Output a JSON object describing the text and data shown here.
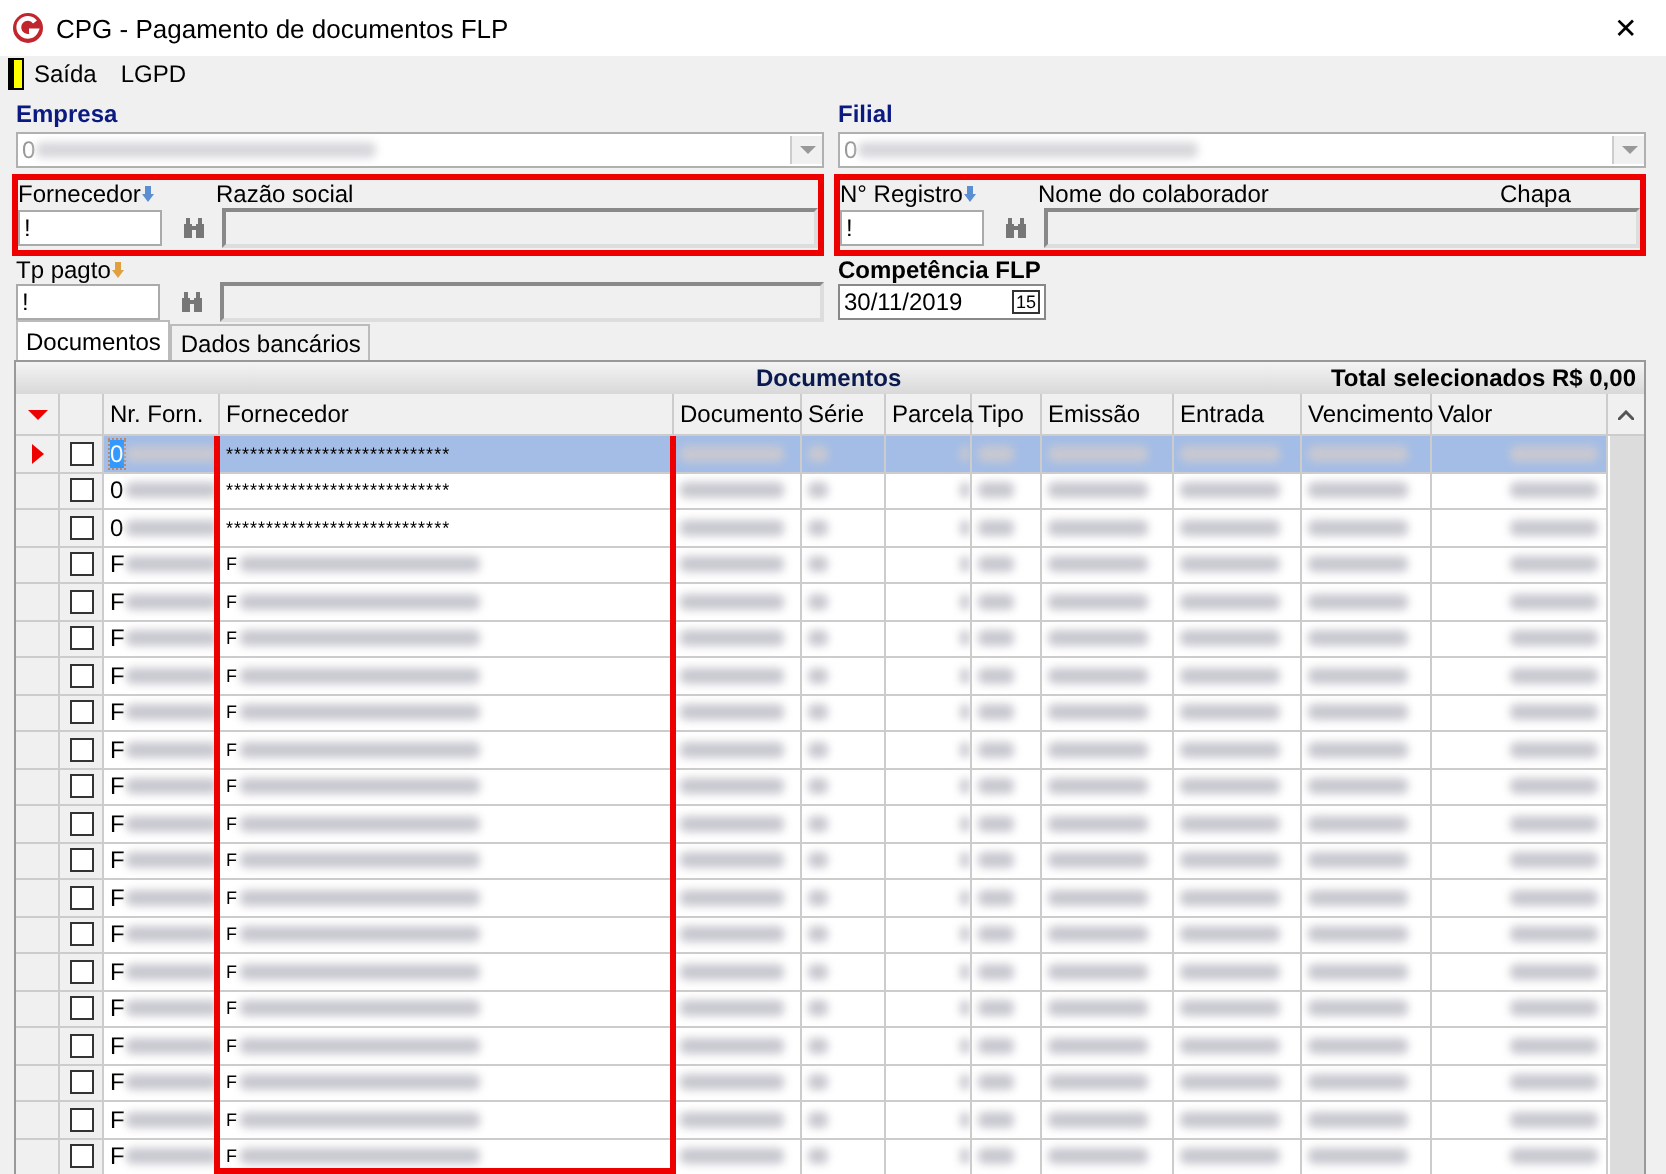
{
  "window": {
    "title": "CPG - Pagamento de documentos FLP",
    "close": "✕"
  },
  "menu": [
    {
      "label": "Saída",
      "kind": "exit"
    },
    {
      "label": "LGPD",
      "kind": "plain"
    }
  ],
  "empresa": {
    "label": "Empresa",
    "value": "0",
    "disabled": true
  },
  "filial": {
    "label": "Filial",
    "value": "0",
    "disabled": true
  },
  "fornecedor": {
    "label": "Fornecedor",
    "value": "!",
    "name_label": "Razão social",
    "highlighted": true
  },
  "registro": {
    "label": "N° Registro",
    "value": "!",
    "name_label": "Nome do colaborador",
    "chapa_label": "Chapa",
    "highlighted": true
  },
  "tp_pagto": {
    "label": "Tp pagto",
    "value": "!"
  },
  "competencia": {
    "label": "Competência FLP",
    "value": "30/11/2019",
    "calendar": "15"
  },
  "tabs": [
    {
      "label": "Documentos",
      "selected": true
    },
    {
      "label": "Dados bancários",
      "selected": false
    }
  ],
  "grid": {
    "title": "Documentos",
    "total": "Total selecionados R$ 0,00",
    "columns": [
      {
        "label": "Nr. Forn.",
        "highlighted": false
      },
      {
        "label": "Fornecedor",
        "highlighted": true
      },
      {
        "label": "Documento",
        "highlighted": false
      },
      {
        "label": "Série",
        "highlighted": false
      },
      {
        "label": "Parcela",
        "highlighted": false
      },
      {
        "label": "Tipo",
        "highlighted": false
      },
      {
        "label": "Emissão",
        "highlighted": false
      },
      {
        "label": "Entrada",
        "highlighted": false
      },
      {
        "label": "Vencimento",
        "highlighted": false
      },
      {
        "label": "Valor",
        "highlighted": false
      }
    ],
    "rows": [
      {
        "nr": "0",
        "fornecedor": "****************************",
        "selected": true,
        "checked": false
      },
      {
        "nr": "0",
        "fornecedor": "****************************",
        "selected": false,
        "checked": false
      },
      {
        "nr": "0",
        "fornecedor": "****************************",
        "selected": false,
        "checked": false
      },
      {
        "nr": "F",
        "fornecedor": "F",
        "selected": false,
        "checked": false
      },
      {
        "nr": "F",
        "fornecedor": "F",
        "selected": false,
        "checked": false
      },
      {
        "nr": "F",
        "fornecedor": "F",
        "selected": false,
        "checked": false
      },
      {
        "nr": "F",
        "fornecedor": "F",
        "selected": false,
        "checked": false
      },
      {
        "nr": "F",
        "fornecedor": "F",
        "selected": false,
        "checked": false
      },
      {
        "nr": "F",
        "fornecedor": "F",
        "selected": false,
        "checked": false
      },
      {
        "nr": "F",
        "fornecedor": "F",
        "selected": false,
        "checked": false
      },
      {
        "nr": "F",
        "fornecedor": "F",
        "selected": false,
        "checked": false
      },
      {
        "nr": "F",
        "fornecedor": "F",
        "selected": false,
        "checked": false
      },
      {
        "nr": "F",
        "fornecedor": "F",
        "selected": false,
        "checked": false
      },
      {
        "nr": "F",
        "fornecedor": "F",
        "selected": false,
        "checked": false
      },
      {
        "nr": "F",
        "fornecedor": "F",
        "selected": false,
        "checked": false
      },
      {
        "nr": "F",
        "fornecedor": "F",
        "selected": false,
        "checked": false
      },
      {
        "nr": "F",
        "fornecedor": "F",
        "selected": false,
        "checked": false
      },
      {
        "nr": "F",
        "fornecedor": "F",
        "selected": false,
        "checked": false
      },
      {
        "nr": "F",
        "fornecedor": "F",
        "selected": false,
        "checked": false
      },
      {
        "nr": "F",
        "fornecedor": "F",
        "selected": false,
        "checked": false
      }
    ]
  }
}
